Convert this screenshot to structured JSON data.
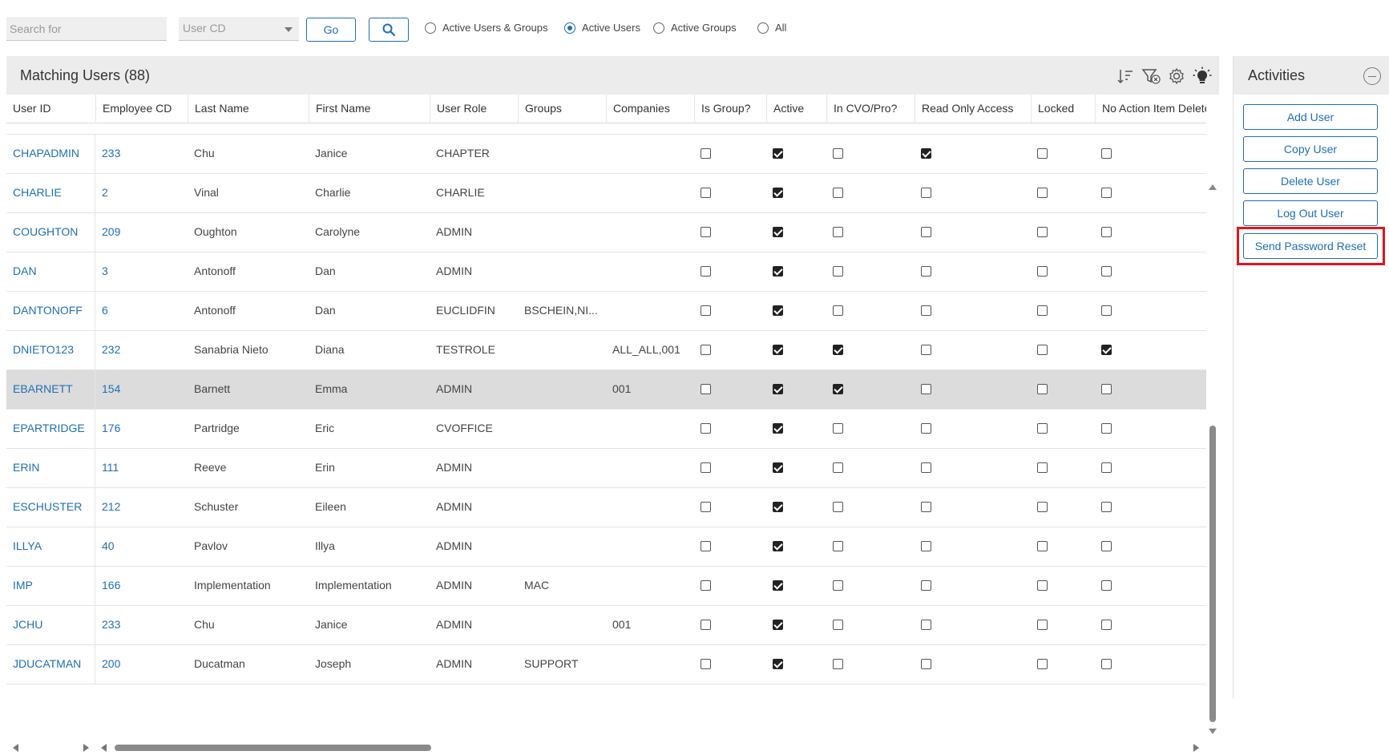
{
  "toolbar": {
    "search_placeholder": "Search for",
    "select_value": "User CD",
    "go_label": "Go",
    "filters": [
      {
        "label": "Active Users & Groups",
        "checked": false
      },
      {
        "label": "Active Users",
        "checked": true
      },
      {
        "label": "Active Groups",
        "checked": false
      },
      {
        "label": "All",
        "checked": false
      }
    ]
  },
  "grid": {
    "title": "Matching Users (88)",
    "header_icons": [
      "sort-icon",
      "clear-filter-icon",
      "settings-gear-icon",
      "lightbulb-icon"
    ],
    "columns": [
      "User ID",
      "Employee CD",
      "Last Name",
      "First Name",
      "User Role",
      "Groups",
      "Companies",
      "Is Group?",
      "Active",
      "In CVO/Pro?",
      "Read Only Access",
      "Locked",
      "No Action Item Delete"
    ],
    "rows": [
      {
        "user_id": "CHAPADMIN",
        "employee_cd": "233",
        "last_name": "Chu",
        "first_name": "Janice",
        "user_role": "CHAPTER",
        "groups": "",
        "companies": "",
        "is_group": false,
        "active": true,
        "in_cvo": false,
        "read_only": true,
        "locked": false,
        "no_action_delete": false,
        "selected": false
      },
      {
        "user_id": "CHARLIE",
        "employee_cd": "2",
        "last_name": "Vinal",
        "first_name": "Charlie",
        "user_role": "CHARLIE",
        "groups": "",
        "companies": "",
        "is_group": false,
        "active": true,
        "in_cvo": false,
        "read_only": false,
        "locked": false,
        "no_action_delete": false,
        "selected": false
      },
      {
        "user_id": "COUGHTON",
        "employee_cd": "209",
        "last_name": "Oughton",
        "first_name": "Carolyne",
        "user_role": "ADMIN",
        "groups": "",
        "companies": "",
        "is_group": false,
        "active": true,
        "in_cvo": false,
        "read_only": false,
        "locked": false,
        "no_action_delete": false,
        "selected": false
      },
      {
        "user_id": "DAN",
        "employee_cd": "3",
        "last_name": "Antonoff",
        "first_name": "Dan",
        "user_role": "ADMIN",
        "groups": "",
        "companies": "",
        "is_group": false,
        "active": true,
        "in_cvo": false,
        "read_only": false,
        "locked": false,
        "no_action_delete": false,
        "selected": false
      },
      {
        "user_id": "DANTONOFF",
        "employee_cd": "6",
        "last_name": "Antonoff",
        "first_name": "Dan",
        "user_role": "EUCLIDFIN",
        "groups": "BSCHEIN,NI...",
        "companies": "",
        "is_group": false,
        "active": true,
        "in_cvo": false,
        "read_only": false,
        "locked": false,
        "no_action_delete": false,
        "selected": false
      },
      {
        "user_id": "DNIETO123",
        "employee_cd": "232",
        "last_name": "Sanabria Nieto",
        "first_name": "Diana",
        "user_role": "TESTROLE",
        "groups": "",
        "companies": "ALL_ALL,001",
        "is_group": false,
        "active": true,
        "in_cvo": true,
        "read_only": false,
        "locked": false,
        "no_action_delete": true,
        "selected": false
      },
      {
        "user_id": "EBARNETT",
        "employee_cd": "154",
        "last_name": "Barnett",
        "first_name": "Emma",
        "user_role": "ADMIN",
        "groups": "",
        "companies": "001",
        "is_group": false,
        "active": true,
        "in_cvo": true,
        "read_only": false,
        "locked": false,
        "no_action_delete": false,
        "selected": true
      },
      {
        "user_id": "EPARTRIDGE",
        "employee_cd": "176",
        "last_name": "Partridge",
        "first_name": "Eric",
        "user_role": "CVOFFICE",
        "groups": "",
        "companies": "",
        "is_group": false,
        "active": true,
        "in_cvo": false,
        "read_only": false,
        "locked": false,
        "no_action_delete": false,
        "selected": false
      },
      {
        "user_id": "ERIN",
        "employee_cd": "111",
        "last_name": "Reeve",
        "first_name": "Erin",
        "user_role": "ADMIN",
        "groups": "",
        "companies": "",
        "is_group": false,
        "active": true,
        "in_cvo": false,
        "read_only": false,
        "locked": false,
        "no_action_delete": false,
        "selected": false
      },
      {
        "user_id": "ESCHUSTER",
        "employee_cd": "212",
        "last_name": "Schuster",
        "first_name": "Eileen",
        "user_role": "ADMIN",
        "groups": "",
        "companies": "",
        "is_group": false,
        "active": true,
        "in_cvo": false,
        "read_only": false,
        "locked": false,
        "no_action_delete": false,
        "selected": false
      },
      {
        "user_id": "ILLYA",
        "employee_cd": "40",
        "last_name": "Pavlov",
        "first_name": "Illya",
        "user_role": "ADMIN",
        "groups": "",
        "companies": "",
        "is_group": false,
        "active": true,
        "in_cvo": false,
        "read_only": false,
        "locked": false,
        "no_action_delete": false,
        "selected": false
      },
      {
        "user_id": "IMP",
        "employee_cd": "166",
        "last_name": "Implementation",
        "first_name": "Implementation",
        "user_role": "ADMIN",
        "groups": "MAC",
        "companies": "",
        "is_group": false,
        "active": true,
        "in_cvo": false,
        "read_only": false,
        "locked": false,
        "no_action_delete": false,
        "selected": false
      },
      {
        "user_id": "JCHU",
        "employee_cd": "233",
        "last_name": "Chu",
        "first_name": "Janice",
        "user_role": "ADMIN",
        "groups": "",
        "companies": "001",
        "is_group": false,
        "active": true,
        "in_cvo": false,
        "read_only": false,
        "locked": false,
        "no_action_delete": false,
        "selected": false
      },
      {
        "user_id": "JDUCATMAN",
        "employee_cd": "200",
        "last_name": "Ducatman",
        "first_name": "Joseph",
        "user_role": "ADMIN",
        "groups": "SUPPORT",
        "companies": "",
        "is_group": false,
        "active": true,
        "in_cvo": false,
        "read_only": false,
        "locked": false,
        "no_action_delete": false,
        "selected": false
      }
    ]
  },
  "activities": {
    "title": "Activities",
    "buttons": [
      "Add User",
      "Copy User",
      "Delete User",
      "Log Out User",
      "Send Password Reset"
    ]
  },
  "colors": {
    "accent": "#1f6fb5",
    "highlight": "#e0161b",
    "header_bg": "#ececec",
    "selected_row": "#dcdcdc"
  }
}
